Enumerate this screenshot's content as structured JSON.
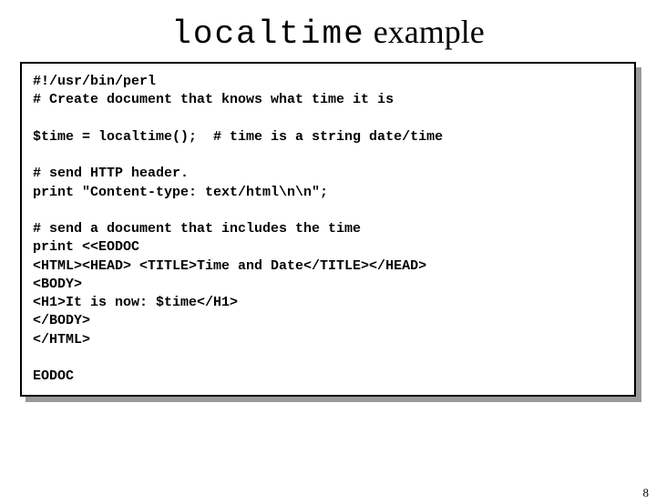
{
  "title": {
    "mono": "localtime",
    "rest": " example"
  },
  "code": "#!/usr/bin/perl\n# Create document that knows what time it is\n\n$time = localtime();  # time is a string date/time\n\n# send HTTP header.\nprint \"Content-type: text/html\\n\\n\";\n\n# send a document that includes the time\nprint <<EODOC\n<HTML><HEAD> <TITLE>Time and Date</TITLE></HEAD>\n<BODY>\n<H1>It is now: $time</H1>\n</BODY>\n</HTML>\n\nEODOC",
  "page_number": "8"
}
